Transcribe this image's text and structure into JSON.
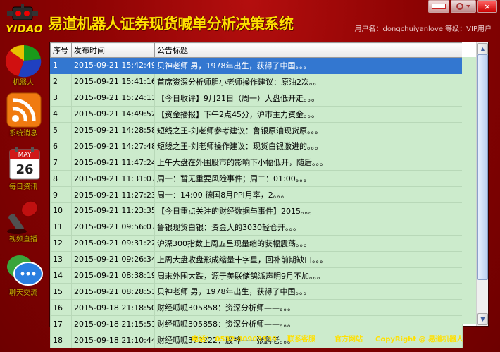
{
  "app": {
    "logo_text": "YIDAO",
    "title": "易道机器人证券现货喊单分析决策系统",
    "user_info": "用户名：dongchuiyanlove 等级：VIP用户"
  },
  "window_controls": {
    "minimize_icon": "minimize-icon",
    "options_icon": "settings-dropdown-icon",
    "close_label": "×"
  },
  "sidebar": {
    "items": [
      {
        "label": "机器人",
        "icon": "pie-chart-icon"
      },
      {
        "label": "系统消息",
        "icon": "rss-feed-icon"
      },
      {
        "label": "每日资讯",
        "icon": "calendar-icon"
      },
      {
        "label": "视频直播",
        "icon": "microphone-icon"
      },
      {
        "label": "聊天交流",
        "icon": "chat-bubble-icon"
      }
    ],
    "calendar_month": "MAY",
    "calendar_day": "26"
  },
  "table": {
    "columns": [
      "序号",
      "发布时间",
      "公告标题"
    ],
    "selected_row": 0,
    "rows": [
      [
        "1",
        "2015-09-21 15:42:49",
        "贝神老师 男，1978年出生，获得了中国。。。"
      ],
      [
        "2",
        "2015-09-21 15:41:16",
        "首席资深分析师胆小老师操作建议：原油2次。。"
      ],
      [
        "3",
        "2015-09-21 15:24:11",
        "【今日收评】9月21日（周一）大盘低开走。。。"
      ],
      [
        "4",
        "2015-09-21 14:49:52",
        "【资金播报】下午2点45分，沪市主力资金。。。"
      ],
      [
        "5",
        "2015-09-21 14:28:58",
        "短线之王-刘老师参考建议：鲁银原油现货原。。。"
      ],
      [
        "6",
        "2015-09-21 14:27:48",
        "短线之王-刘老师操作建议：现货白银激进的。。。"
      ],
      [
        "7",
        "2015-09-21 11:47:24",
        "上午大盘在外围股市的影响下小幅低开，随后。。。"
      ],
      [
        "8",
        "2015-09-21 11:31:07",
        "周一：暂无重要风险事件；周二：01:00。。。"
      ],
      [
        "9",
        "2015-09-21 11:27:23",
        "周一：14:00 德国8月PPI月率，2。。。"
      ],
      [
        "10",
        "2015-09-21 11:23:35",
        "【今日重点关注的财经数据与事件】2015。。。"
      ],
      [
        "11",
        "2015-09-21 09:56:07",
        "鲁银现货白银：资金大的3030轻仓开。。。"
      ],
      [
        "12",
        "2015-09-21 09:31:22",
        " 沪深300指数上周五呈现量缩的获幅震荡。。。"
      ],
      [
        "13",
        "2015-09-21 09:26:34",
        "上周大盘收盘形成缩量十字星，回补前期缺口。。。"
      ],
      [
        "14",
        "2015-09-21 08:38:19",
        "周末外围大跌，源于美联储鸽派声明9月不加。。。"
      ],
      [
        "15",
        "2015-09-21 08:28:51",
        "贝神老师 男，1978年出生，获得了中国。。。"
      ],
      [
        "16",
        "2015-09-18 21:18:50",
        "财经呱呱305858：资深分析师——。。。"
      ],
      [
        "17",
        "2015-09-18 21:15:51",
        "财经呱呱305858：资深分析师——。。。"
      ],
      [
        "18",
        "2015-09-18 21:10:44",
        "财经呱呱372222：股神——张鹏老。。。"
      ]
    ]
  },
  "footer": {
    "phone": "电话：  0532-80903539",
    "contact": "联系客服",
    "website": "官方网站",
    "copyright": "CopyRight @ 易道机器人"
  }
}
